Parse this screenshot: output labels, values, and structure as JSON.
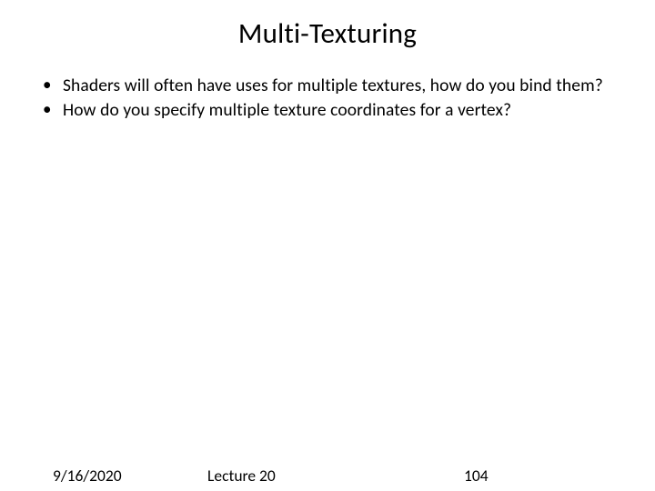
{
  "title": "Multi-Texturing",
  "bullets": [
    "Shaders will often have uses for multiple textures, how do you bind them?",
    "How do you specify multiple texture coordinates for a vertex?"
  ],
  "footer": {
    "date": "9/16/2020",
    "lecture": "Lecture 20",
    "page": "104"
  }
}
